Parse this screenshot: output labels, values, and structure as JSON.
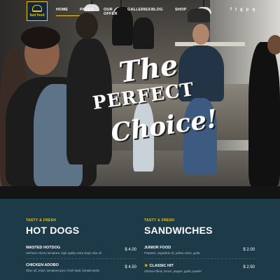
{
  "nav": {
    "logo_text": "fast food",
    "items": [
      "HOME",
      "PAGES",
      "OUR OFFER",
      "GALLERIES",
      "BLOG",
      "SHOP"
    ],
    "active_index": 0,
    "social": [
      "f",
      "t",
      "g",
      "p",
      "q"
    ]
  },
  "hero": {
    "line1": "The",
    "line2": "PERFECT",
    "line3": "Choice!"
  },
  "menu": {
    "left": {
      "tag": "TASTY & FRESH",
      "title": "HOT DOGS",
      "items": [
        {
          "name": "WASTED HOTDOG",
          "desc": "Heirloom cherry tomatoes, high quality extra virgin olive oil",
          "price": "$ 4.00"
        },
        {
          "name": "CHICKEN ADOBO",
          "desc": "Olive oil, onion, tomatoes juice, fresh basil, breadcrumbs",
          "price": "$ 4.50"
        }
      ]
    },
    "right": {
      "tag": "TASTY & FRESH",
      "title": "SANDWICHES",
      "items": [
        {
          "name": "JUNIOR FOOD",
          "desc": "Potatoes, vegetable oil, yellow onion, garlic",
          "price": "$ 2.00"
        },
        {
          "name": "CLASSIC HIT",
          "desc": "Chicken fillets, lemon, pepper, garlic powder",
          "price": "$ 2.50"
        }
      ]
    }
  },
  "colors": {
    "accent": "#f1c40f",
    "section_bg": "#1d3a48"
  }
}
